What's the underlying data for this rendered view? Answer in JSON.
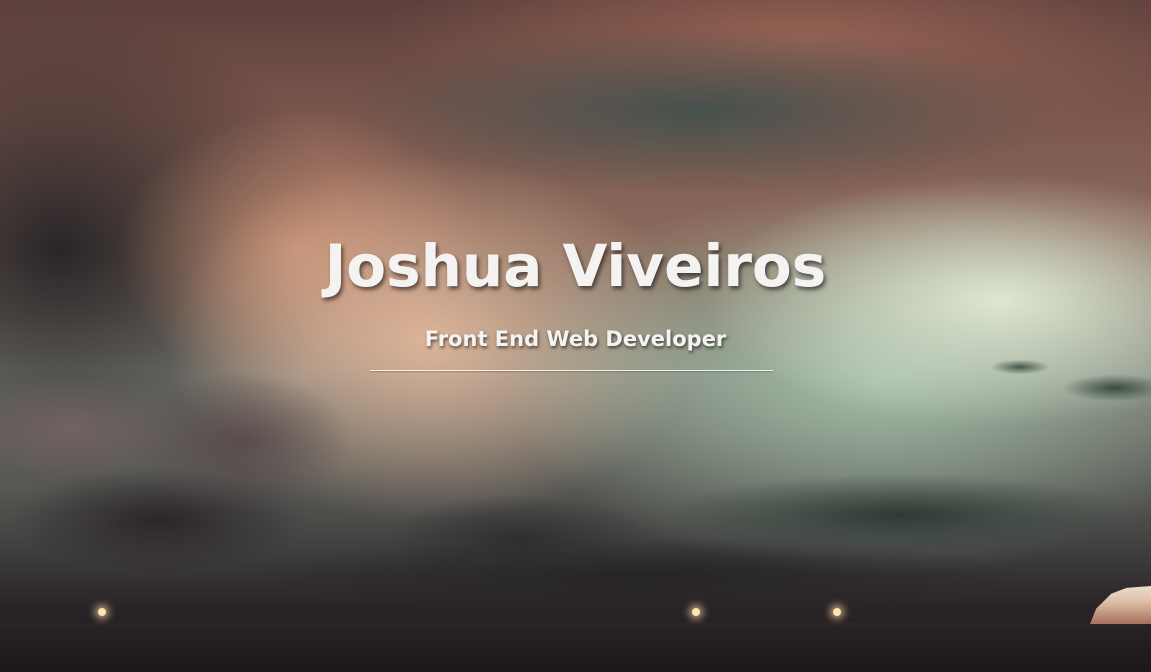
{
  "hero": {
    "name": "Joshua Viveiros",
    "subtitle": "Front End Web Developer",
    "background": "sunset-cloudscape-over-sea",
    "text_color": "#f5f3f2"
  }
}
